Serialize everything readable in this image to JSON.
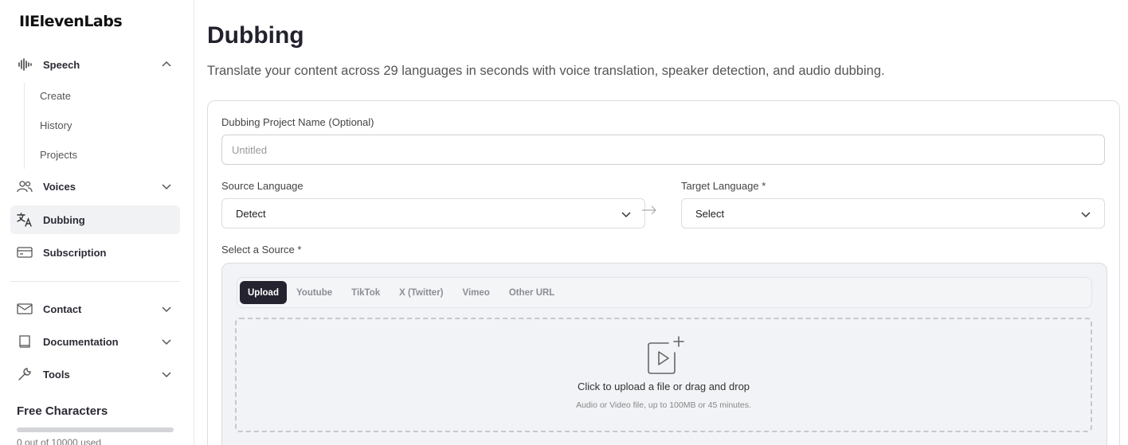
{
  "brand": {
    "name": "IIElevenLabs"
  },
  "sidebar": {
    "speech": {
      "label": "Speech",
      "icon": "waveform-icon"
    },
    "speech_sub": [
      {
        "label": "Create"
      },
      {
        "label": "History"
      },
      {
        "label": "Projects"
      }
    ],
    "voices": {
      "label": "Voices",
      "icon": "users-icon"
    },
    "dubbing": {
      "label": "Dubbing",
      "icon": "translate-icon"
    },
    "subscription": {
      "label": "Subscription",
      "icon": "card-icon"
    },
    "contact": {
      "label": "Contact",
      "icon": "mail-icon"
    },
    "documentation": {
      "label": "Documentation",
      "icon": "book-icon"
    },
    "tools": {
      "label": "Tools",
      "icon": "wrench-icon"
    },
    "quota": {
      "title": "Free Characters",
      "usage_text": "0 out of 10000 used",
      "used_fraction": 0
    }
  },
  "main": {
    "title": "Dubbing",
    "subtitle": "Translate your content across 29 languages in seconds with voice translation, speaker detection, and audio dubbing.",
    "form": {
      "project_name_label": "Dubbing Project Name (Optional)",
      "project_name_placeholder": "Untitled",
      "project_name_value": "",
      "source_language_label": "Source Language",
      "source_language_value": "Detect",
      "target_language_label": "Target Language *",
      "target_language_value": "Select",
      "select_source_label": "Select a Source *",
      "tabs": [
        {
          "label": "Upload",
          "active": true
        },
        {
          "label": "Youtube"
        },
        {
          "label": "TikTok"
        },
        {
          "label": "X (Twitter)"
        },
        {
          "label": "Vimeo"
        },
        {
          "label": "Other URL"
        }
      ],
      "dropzone": {
        "text": "Click to upload a file or drag and drop",
        "hint": "Audio or Video file, up to 100MB or 45 minutes."
      }
    }
  },
  "colors": {
    "accent_dark": "#24232f",
    "active_nav_bg": "#f1f2f4",
    "dropzone_bg": "#f1f3f6"
  }
}
